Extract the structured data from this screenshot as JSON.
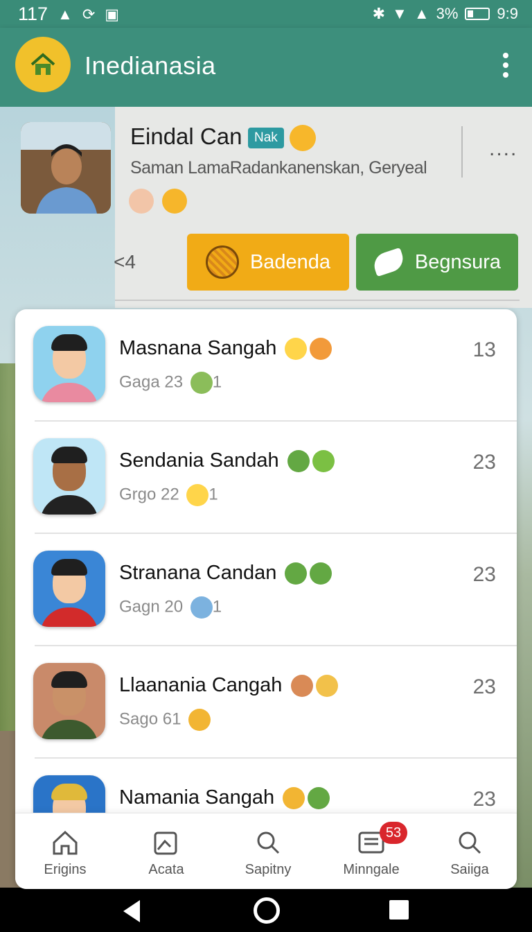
{
  "status_bar": {
    "time_left": "117",
    "battery_text": "3%",
    "time_right": "9:9"
  },
  "app_bar": {
    "title": "Inedianasia",
    "home_icon": "home-icon",
    "menu_icon": "more-vert-icon",
    "accent_color": "#3d8f7c",
    "home_color": "#f1c12b"
  },
  "profile": {
    "name": "Eindal Can",
    "badge": "Nak",
    "subtitle": "Saman LamaRadankanenskan, Geryeal",
    "more": "....",
    "count_lead": "<4"
  },
  "actions": {
    "primary_label": "Badenda",
    "primary_color": "#f1ab16",
    "secondary_label": "Begnsura",
    "secondary_color": "#4f9a45"
  },
  "contacts": [
    {
      "name": "Masnana Sangah",
      "sub": "Gaga 23",
      "sub_count": "1",
      "count": "13"
    },
    {
      "name": "Sendania Sandah",
      "sub": "Grgo 22",
      "sub_count": "1",
      "count": "23"
    },
    {
      "name": "Stranana Candan",
      "sub": "Gagn 20",
      "sub_count": "1",
      "count": "23"
    },
    {
      "name": "Llaanania Cangah",
      "sub": "Sago 61",
      "sub_count": "",
      "count": "23"
    },
    {
      "name": "Namania Sangah",
      "sub": "",
      "sub_count": "",
      "count": "23"
    }
  ],
  "bottom_nav": [
    {
      "label": "Erigins",
      "icon": "home-outline-icon"
    },
    {
      "label": "Acata",
      "icon": "image-edit-icon"
    },
    {
      "label": "Sapitny",
      "icon": "search-icon"
    },
    {
      "label": "Minngale",
      "icon": "message-icon",
      "badge": "53"
    },
    {
      "label": "Saiiga",
      "icon": "search-alt-icon"
    }
  ]
}
